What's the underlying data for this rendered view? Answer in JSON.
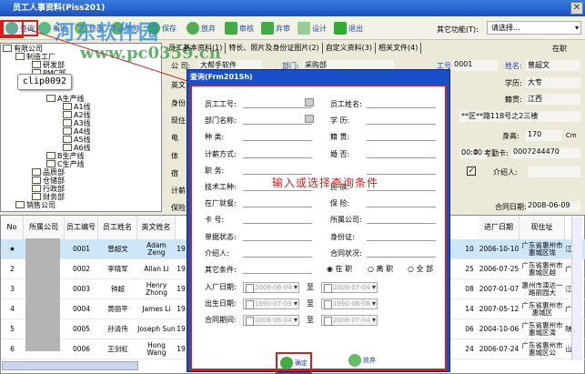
{
  "window": {
    "title": "员工人事资料(Piss201)",
    "close": "✕"
  },
  "toolbar": {
    "buttons": [
      "查询",
      "新增",
      "修改",
      "删除",
      "保存",
      "放弃",
      "审核",
      "弃审",
      "设计",
      "退出"
    ],
    "other_label": "其它功能(T):",
    "other_value": "请选择..."
  },
  "watermark": {
    "logo": "河东软件园",
    "url": "www.pc0359.cn"
  },
  "tooltip": "clip0092",
  "tree": {
    "root": "有限公司",
    "items": [
      "制造工厂",
      "研发部",
      "PMC部",
      "A生产线",
      "A1线",
      "A2线",
      "A3线",
      "A4线",
      "A5线",
      "A6线",
      "B生产线",
      "C生产线",
      "品质部",
      "仓储部",
      "行政部",
      "财务部",
      "销售公司"
    ]
  },
  "tabs": [
    "员工基本资料(1)",
    "特长、照片及身份证图片(2)",
    "自定义资料(3)",
    "相关文件(4)"
  ],
  "status": "在职",
  "form": {
    "company_label": "公  司:",
    "company": "大帮手软件",
    "dept_label": "部门:",
    "dept": "采购部",
    "id_label": "工号:",
    "id": "0001",
    "name_label": "姓名:",
    "name": "曾超文",
    "edu_label": "学历:",
    "edu": "大专",
    "origin_label": "籍贯:",
    "origin": "江西",
    "address": "**区**路118号之2三楼",
    "height_label": "身高:",
    "height": "170",
    "height_unit": "Cm",
    "time": "00:00",
    "card_label": "考勤卡:",
    "card": "0007244470",
    "intro_label": "介绍人:",
    "contract_date_label": "合同日期:",
    "contract_date": "2008-06-09",
    "left_labels": [
      "英文",
      "身份",
      "现住",
      "电",
      "体",
      "宿",
      "计薪",
      "保险"
    ]
  },
  "grid": {
    "headers": [
      "No",
      "所属公司",
      "员工编号",
      "员工姓名",
      "英文姓名",
      "进厂日期",
      "现住址"
    ],
    "rows": [
      {
        "no": "★",
        "id": "0001",
        "name": "曾超文",
        "en": "Adam Zeng",
        "yr": "19",
        "bd": "10",
        "join": "2006-10-10",
        "addr": "广东省惠州市惠城区珑",
        "x": "江"
      },
      {
        "no": "2",
        "id": "0002",
        "name": "李晓军",
        "en": "Allan Li",
        "yr": "19",
        "bd": "25",
        "join": "2006-07-25",
        "addr": "广东省惠州市惠城区越",
        "x": "广"
      },
      {
        "no": "3",
        "id": "0003",
        "name": "钟超",
        "en": "Henry Zhong",
        "yr": "19",
        "bd": "08",
        "join": "2007-01-07",
        "addr": "惠州市演达一路丽园大",
        "x": "江"
      },
      {
        "no": "4",
        "id": "0004",
        "name": "黄丽平",
        "en": "James Li",
        "yr": "19",
        "bd": "14",
        "join": "2007-05-12",
        "addr": "广东省惠州市惠城区",
        "x": "广"
      },
      {
        "no": "5",
        "id": "0005",
        "name": "孙清伟",
        "en": "Joseph Sun",
        "yr": "19",
        "bd": "06",
        "join": "2004-10-06",
        "addr": "广东省惠州市惠城区演",
        "x": "陕"
      },
      {
        "no": "6",
        "id": "0006",
        "name": "王剑虹",
        "en": "Hong Wang",
        "yr": "19",
        "bd": "24",
        "join": "2006-07-24",
        "addr": "广东省惠州市惠城区公",
        "x": "山"
      }
    ]
  },
  "dialog": {
    "title": "查询(Frm201Sh)",
    "hint": "输入或选择查询条件",
    "left_labels": [
      "员工工号:",
      "部门名称:",
      "种    类:",
      "计薪方式:",
      "职    务:",
      "技术工种:",
      "在厂就餐:",
      "卡    号:",
      "单据状态:",
      "介绍人:",
      "其它条件:"
    ],
    "right_labels": [
      "员工姓名:",
      "学  历:",
      "籍  贯:",
      "婚  否:",
      "",
      "民  族:",
      "保  险:",
      "所属公司:",
      "身份证:",
      "合同状况:"
    ],
    "radios": [
      "在 职",
      "离 职",
      "全 部"
    ],
    "date_rows": [
      {
        "label": "入厂日期:",
        "from": "2008-06-04",
        "to": "2008-07-04"
      },
      {
        "label": "出生日期:",
        "from": "1990-07-09",
        "to": "1990-06-08"
      },
      {
        "label": "合同期间:",
        "from": "2008-06-04",
        "to": "2008-07-04"
      }
    ],
    "to_label": "至",
    "ok": "确定",
    "cancel": "放弃"
  }
}
